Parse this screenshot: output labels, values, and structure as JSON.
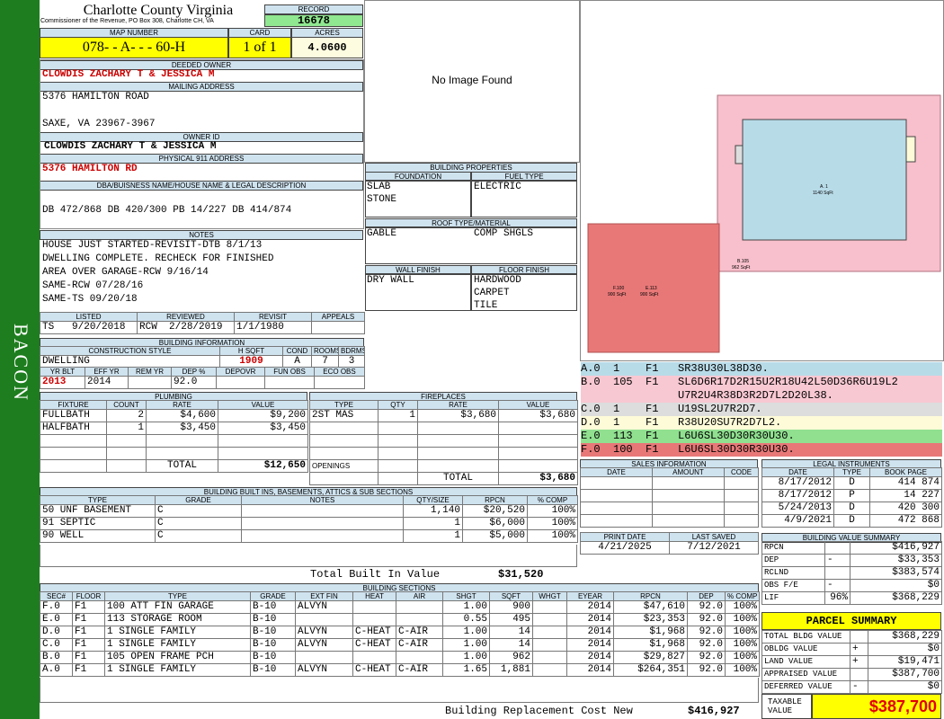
{
  "sideband": "BACON",
  "header": {
    "county": "Charlotte County Virginia",
    "commissioner": "Commissioner of the Revenue, PO Box 308, Charlotte CH, VA",
    "record_label": "RECORD",
    "record": "16678",
    "map_label": "MAP NUMBER",
    "map_number": "078-  - A-   -   - 60-H",
    "card_label": "CARD",
    "card": "1 of 1",
    "acres_label": "ACRES",
    "acres": "4.0600"
  },
  "owner": {
    "deeded_label": "DEEDED OWNER",
    "deeded": "CLOWDIS ZACHARY T & JESSICA M",
    "mailing_label": "MAILING ADDRESS",
    "mailing1": "5376 HAMILTON ROAD",
    "mailing2": "SAXE, VA 23967-3967",
    "ownerid_label": "OWNER ID",
    "ownerid": "CLOWDIS ZACHARY T & JESSICA M",
    "physical_label": "PHYSICAL 911 ADDRESS",
    "physical": "5376 HAMILTON RD",
    "dba_label": "DBA/BUISNESS NAME/HOUSE NAME & LEGAL DESCRIPTION",
    "legal": "DB 472/868 DB 420/300 PB 14/227 DB 414/874"
  },
  "notes": {
    "label": "NOTES",
    "lines": [
      "HOUSE JUST STARTED-REVISIT-DTB 8/1/13",
      "DWELLING COMPLETE. RECHECK FOR FINISHED",
      "AREA OVER GARAGE-RCW 9/16/14",
      "SAME-RCW 07/28/16",
      "SAME-TS 09/20/18"
    ]
  },
  "review": {
    "listed_label": "LISTED",
    "reviewed_label": "REVIEWED",
    "revisit_label": "REVISIT",
    "appeals_label": "APPEALS",
    "listed_by": "TS",
    "listed": "9/20/2018",
    "reviewed_by": "RCW",
    "reviewed": "2/28/2019",
    "revisit": "1/1/1980"
  },
  "building_info": {
    "label": "BUILDING INFORMATION",
    "h_style": "CONSTRUCTION STYLE",
    "h_sqft": "H SQFT",
    "h_cond": "COND",
    "h_rooms": "ROOMS",
    "h_bdrms": "BDRMS",
    "style": "DWELLING",
    "sqft": "1909",
    "cond": "A",
    "rooms": "7",
    "bdrms": "3",
    "h_yrblt": "YR BLT",
    "h_effyr": "EFF YR",
    "h_remyr": "REM YR",
    "h_dep": "DEP %",
    "h_depovr": "DEPOVR",
    "h_funobs": "FUN OBS",
    "h_ecoobs": "ECO OBS",
    "yrblt": "2013",
    "effyr": "2014",
    "dep": "92.0"
  },
  "no_image": "No Image Found",
  "building_properties": {
    "label": "BUILDING PROPERTIES",
    "foundation_label": "FOUNDATION",
    "fuel_label": "FUEL TYPE",
    "foundation1": "SLAB",
    "foundation2": "STONE",
    "fuel": "ELECTRIC",
    "roof_label": "ROOF TYPE/MATERIAL",
    "roof_type": "GABLE",
    "roof_material": "COMP SHGLS",
    "wall_label": "WALL FINISH",
    "floor_label": "FLOOR FINISH",
    "wall": "DRY WALL",
    "floor1": "HARDWOOD",
    "floor2": "CARPET",
    "floor3": "TILE"
  },
  "sketch": {
    "rows": [
      {
        "text": "A.0  1    F1   SR38U30L38D30.",
        "color": "#b8dbe8"
      },
      {
        "text": "B.0  105  F1   SL6D6R17D2R15U2R18U42L50D36R6U19L2",
        "color": "#f8c8d2"
      },
      {
        "text": "               U7R2U4R38D3R2D7L2D20L38.",
        "color": "#f8c8d2"
      },
      {
        "text": "C.0  1    F1   U19SL2U7R2D7.",
        "color": "#dddddd"
      },
      {
        "text": "D.0  1    F1   R38U20SU7R2D7L2.",
        "color": "#fdfbd8"
      },
      {
        "text": "E.0  113  F1   L6U6SL30D30R30U30.",
        "color": "#90e090"
      },
      {
        "text": "F.0  100  F1   L6U6SL30D30R30U30.",
        "color": "#e87878"
      }
    ],
    "a_label": "A. 1",
    "a_sqft": "1140 SqFt",
    "b_label": "B.105",
    "b_sqft": "962 SqFt",
    "ef_label1": "F.100",
    "ef_label2": "E.113",
    "ef_sqft1": "900 SqFt",
    "ef_sqft2": "900 SqFt"
  },
  "plumbing": {
    "label": "PLUMBING",
    "h": [
      "FIXTURE",
      "COUNT",
      "RATE",
      "VALUE"
    ],
    "rows": [
      [
        "FULLBATH",
        "2",
        "$4,600",
        "$9,200"
      ],
      [
        "HALFBATH",
        "1",
        "$3,450",
        "$3,450"
      ]
    ],
    "total_label": "TOTAL",
    "total": "$12,650"
  },
  "fireplaces": {
    "label": "FIREPLACES",
    "h": [
      "TYPE",
      "QTY",
      "RATE",
      "VALUE"
    ],
    "rows": [
      [
        "2ST MAS",
        "1",
        "$3,680",
        "$3,680"
      ]
    ],
    "openings_label": "OPENINGS",
    "total_label": "TOTAL",
    "total": "$3,680"
  },
  "sales": {
    "label": "SALES INFORMATION",
    "h": [
      "DATE",
      "AMOUNT",
      "CODE"
    ]
  },
  "legal": {
    "label": "LEGAL INSTRUMENTS",
    "h": [
      "DATE",
      "TYPE",
      "BOOK PAGE"
    ],
    "rows": [
      [
        "8/17/2012",
        "D",
        "414 874"
      ],
      [
        "8/17/2012",
        "P",
        "14 227"
      ],
      [
        "5/24/2013",
        "D",
        "420 300"
      ],
      [
        "4/9/2021",
        "D",
        "472 868"
      ]
    ]
  },
  "print": {
    "print_label": "PRINT DATE",
    "saved_label": "LAST SAVED",
    "print_date": "4/21/2025",
    "last_saved": "7/12/2021"
  },
  "builtins": {
    "label": "BUILDING BUILT INS, BASEMENTS, ATTICS & SUB SECTIONS",
    "h": [
      "TYPE",
      "GRADE",
      "NOTES",
      "QTY/SIZE",
      "RPCN",
      "% COMP"
    ],
    "rows": [
      [
        "50 UNF BASEMENT",
        "C",
        "",
        "1,140",
        "$20,520",
        "100%"
      ],
      [
        "91 SEPTIC",
        "C",
        "",
        "1",
        "$6,000",
        "100%"
      ],
      [
        "90 WELL",
        "C",
        "",
        "1",
        "$5,000",
        "100%"
      ]
    ],
    "total_label": "Total Built In Value",
    "total": "$31,520"
  },
  "sections": {
    "label": "BUILDING SECTIONS",
    "h": [
      "SEC#",
      "FLOOR",
      "TYPE",
      "GRADE",
      "EXT FIN",
      "HEAT",
      "AIR",
      "SHGT",
      "SQFT",
      "WHGT",
      "EYEAR",
      "RPCN",
      "DEP",
      "% COMP"
    ],
    "rows": [
      [
        "F.0",
        "F1",
        "100 ATT FIN GARAGE",
        "B-10",
        "ALVYN",
        "",
        "",
        "1.00",
        "900",
        "",
        "2014",
        "$47,610",
        "92.0",
        "100%"
      ],
      [
        "E.0",
        "F1",
        "113 STORAGE ROOM",
        "B-10",
        "",
        "",
        "",
        "0.55",
        "495",
        "",
        "2014",
        "$23,353",
        "92.0",
        "100%"
      ],
      [
        "D.0",
        "F1",
        "1 SINGLE FAMILY",
        "B-10",
        "ALVYN",
        "C-HEAT",
        "C-AIR",
        "1.00",
        "14",
        "",
        "2014",
        "$1,968",
        "92.0",
        "100%"
      ],
      [
        "C.0",
        "F1",
        "1 SINGLE FAMILY",
        "B-10",
        "ALVYN",
        "C-HEAT",
        "C-AIR",
        "1.00",
        "14",
        "",
        "2014",
        "$1,968",
        "92.0",
        "100%"
      ],
      [
        "B.0",
        "F1",
        "105 OPEN FRAME PCH",
        "B-10",
        "",
        "",
        "",
        "1.00",
        "962",
        "",
        "2014",
        "$29,827",
        "92.0",
        "100%"
      ],
      [
        "A.0",
        "F1",
        "1 SINGLE FAMILY",
        "B-10",
        "ALVYN",
        "C-HEAT",
        "C-AIR",
        "1.65",
        "1,881",
        "",
        "2014",
        "$264,351",
        "92.0",
        "100%"
      ]
    ],
    "replacement_label": "Building Replacement Cost New",
    "replacement": "$416,927"
  },
  "value_summary": {
    "label": "BUILDING VALUE SUMMARY",
    "rows": [
      [
        "RPCN",
        "",
        "$416,927"
      ],
      [
        "DEP",
        "-",
        "$33,353"
      ],
      [
        "RCLND",
        "",
        "$383,574"
      ],
      [
        "OBS F/E",
        "-",
        "$0"
      ],
      [
        "LIF",
        "96%",
        "$368,229"
      ]
    ]
  },
  "parcel": {
    "label": "PARCEL SUMMARY",
    "rows": [
      [
        "TOTAL BLDG VALUE",
        "",
        "$368,229"
      ],
      [
        "OBLDG VALUE",
        "+",
        "$0"
      ],
      [
        "LAND VALUE",
        "+",
        "$19,471"
      ],
      [
        "APPRAISED VALUE",
        "",
        "$387,700"
      ],
      [
        "DEFERRED VALUE",
        "-",
        "$0"
      ]
    ],
    "taxable_label1": "TAXABLE",
    "taxable_label2": "VALUE",
    "taxable": "$387,700"
  }
}
